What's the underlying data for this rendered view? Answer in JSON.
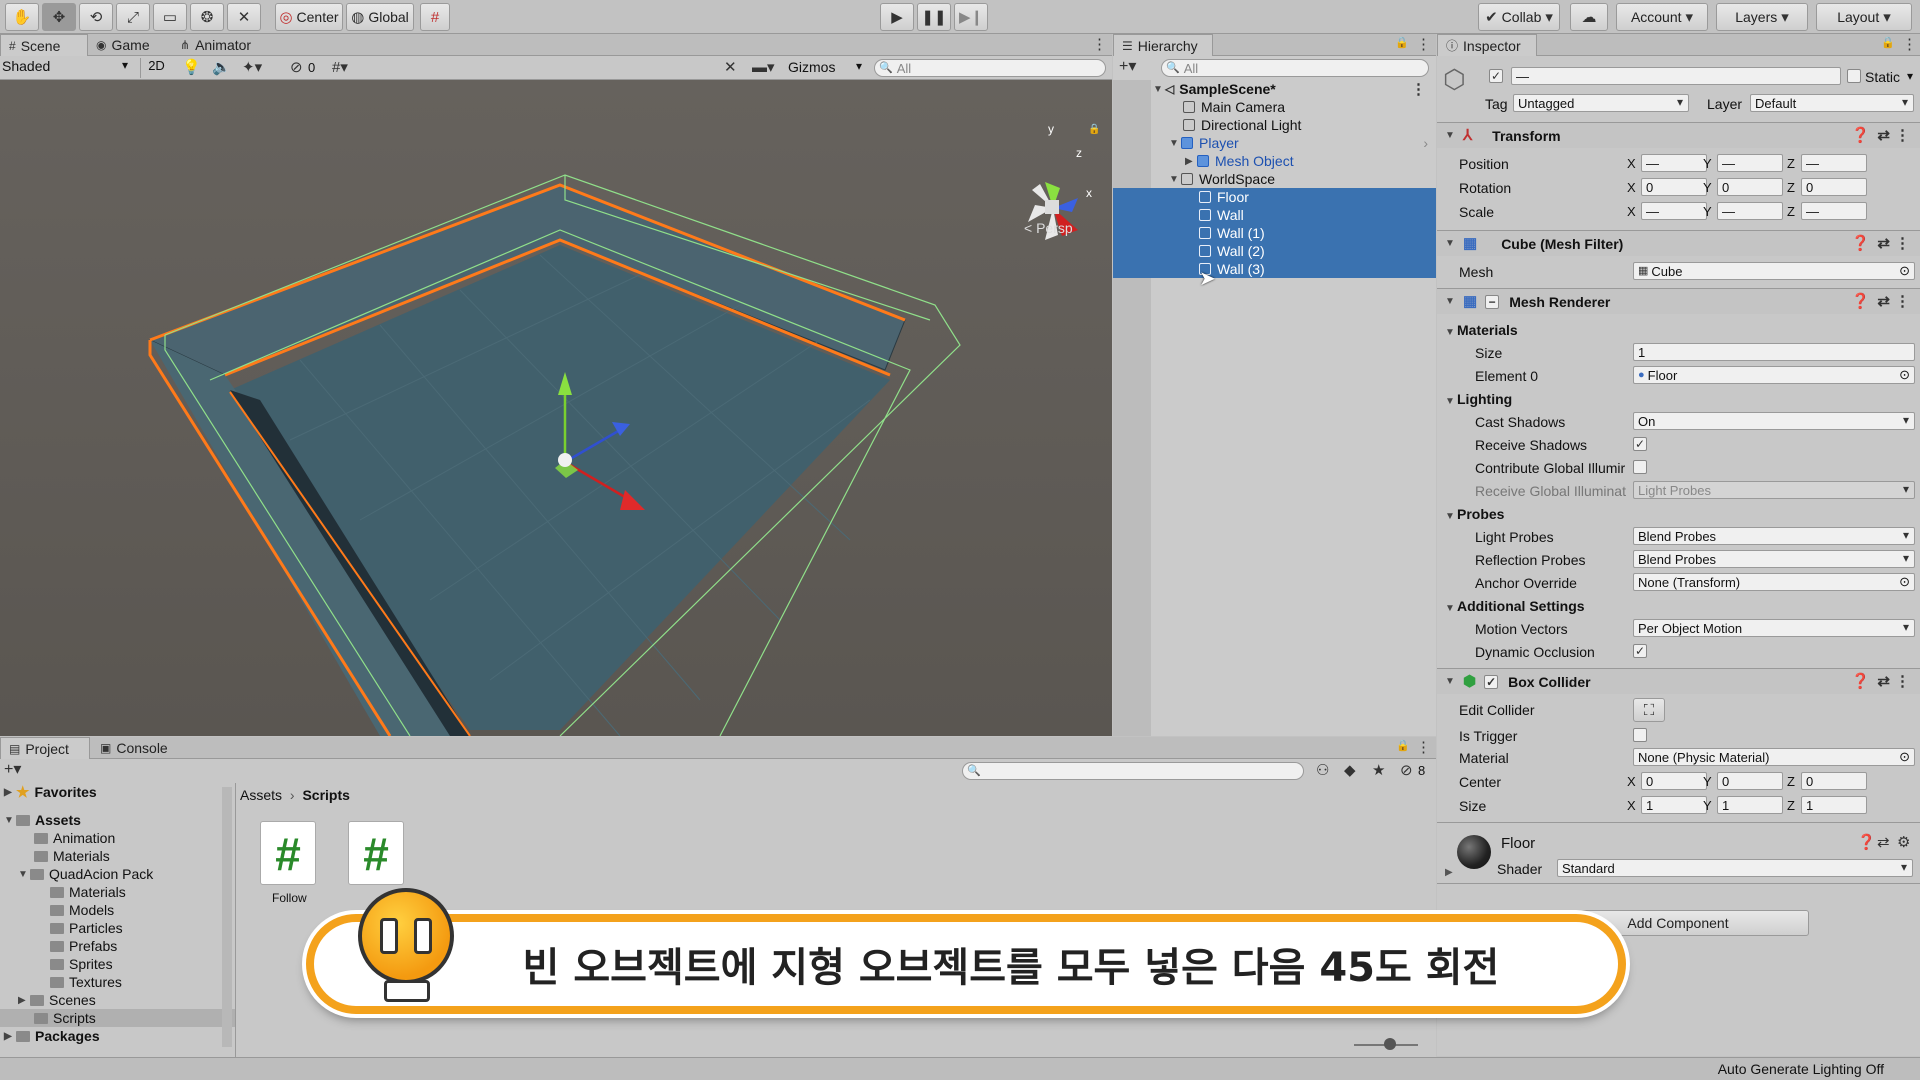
{
  "toolbar": {
    "center_label": "Center",
    "global_label": "Global",
    "collab_label": "Collab",
    "account_label": "Account",
    "layers_label": "Layers",
    "layout_label": "Layout"
  },
  "scene": {
    "tabs": [
      "Scene",
      "Game",
      "Animator"
    ],
    "shading_mode": "Shaded",
    "mode_2d": "2D",
    "hidden_count": "0",
    "gizmos_label": "Gizmos",
    "search_placeholder": "All",
    "persp_label": "< Persp",
    "axis_x": "x",
    "axis_y": "y",
    "axis_z": "z"
  },
  "hierarchy": {
    "tab_label": "Hierarchy",
    "search_placeholder": "All",
    "scene_name": "SampleScene*",
    "items": [
      "Main Camera",
      "Directional Light",
      "Player",
      "Mesh Object",
      "WorldSpace",
      "Floor",
      "Wall",
      "Wall (1)",
      "Wall (2)",
      "Wall (3)"
    ]
  },
  "inspector": {
    "tab_label": "Inspector",
    "name_value": "—",
    "static_label": "Static",
    "tag_label": "Tag",
    "tag_value": "Untagged",
    "layer_label": "Layer",
    "layer_value": "Default",
    "transform": {
      "title": "Transform",
      "position_label": "Position",
      "rotation_label": "Rotation",
      "scale_label": "Scale",
      "position": [
        "—",
        "—",
        "—"
      ],
      "rotation": [
        "0",
        "0",
        "0"
      ],
      "scale": [
        "—",
        "—",
        "—"
      ],
      "axis_labels": [
        "X",
        "Y",
        "Z"
      ]
    },
    "mesh_filter": {
      "title": "Cube (Mesh Filter)",
      "mesh_label": "Mesh",
      "mesh_value": "Cube"
    },
    "mesh_renderer": {
      "title": "Mesh Renderer",
      "materials_label": "Materials",
      "size_label": "Size",
      "size_value": "1",
      "element0_label": "Element 0",
      "element0_value": "Floor",
      "lighting_label": "Lighting",
      "cast_shadows_label": "Cast Shadows",
      "cast_shadows_value": "On",
      "receive_shadows_label": "Receive Shadows",
      "contribute_gi_label": "Contribute Global Illumir",
      "receive_gi_label": "Receive Global Illuminat",
      "receive_gi_value": "Light Probes",
      "probes_label": "Probes",
      "light_probes_label": "Light Probes",
      "light_probes_value": "Blend Probes",
      "reflection_probes_label": "Reflection Probes",
      "reflection_probes_value": "Blend Probes",
      "anchor_override_label": "Anchor Override",
      "anchor_override_value": "None (Transform)",
      "additional_label": "Additional Settings",
      "motion_vectors_label": "Motion Vectors",
      "motion_vectors_value": "Per Object Motion",
      "dynamic_occlusion_label": "Dynamic Occlusion"
    },
    "box_collider": {
      "title": "Box Collider",
      "edit_collider_label": "Edit Collider",
      "is_trigger_label": "Is Trigger",
      "material_label": "Material",
      "material_value": "None (Physic Material)",
      "center_label": "Center",
      "center": [
        "0",
        "0",
        "0"
      ],
      "size_label": "Size",
      "size": [
        "1",
        "1",
        "1"
      ]
    },
    "material": {
      "name": "Floor",
      "shader_label": "Shader",
      "shader_value": "Standard"
    },
    "add_component_label": "Add Component"
  },
  "project": {
    "tabs": [
      "Project",
      "Console"
    ],
    "hidden_count": "8",
    "favorites_label": "Favorites",
    "assets_label": "Assets",
    "tree": [
      "Animation",
      "Materials",
      "QuadAcion Pack",
      "Materials",
      "Models",
      "Particles",
      "Prefabs",
      "Sprites",
      "Textures",
      "Scenes",
      "Scripts"
    ],
    "packages_label": "Packages",
    "breadcrumb": [
      "Assets",
      "Scripts"
    ],
    "files": [
      "Follow"
    ]
  },
  "subtitle": "빈 오브젝트에 지형 오브젝트를 모두 넣은 다음 45도 회전",
  "status_bar": "Auto Generate Lighting Off",
  "colors": {
    "selection": "#3a72b0",
    "scene_bg": "#5e5a55",
    "floor": "#3f5a66",
    "outline": "#ff7a1a",
    "collider": "#90e08a",
    "subtitle_border": "#f4a21c"
  }
}
